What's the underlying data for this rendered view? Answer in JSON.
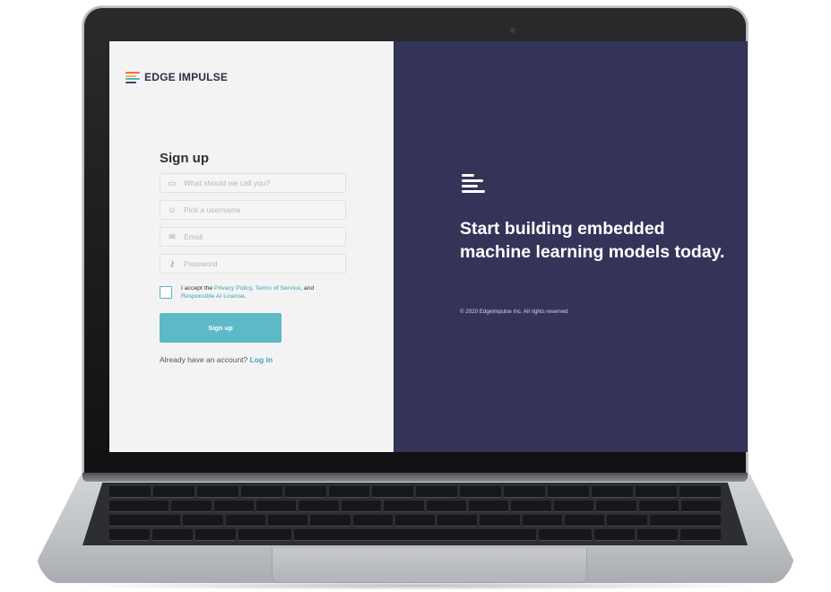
{
  "brand": {
    "name": "EDGE IMPULSE",
    "logo_colors": [
      "#f26d50",
      "#f7b733",
      "#4db6c5",
      "#3e3e6b"
    ]
  },
  "signup_form": {
    "title": "Sign up",
    "fields": [
      {
        "icon": "id-card-icon",
        "placeholder": "What should we call you?",
        "value": ""
      },
      {
        "icon": "user-icon",
        "placeholder": "Pick a username",
        "value": ""
      },
      {
        "icon": "mail-icon",
        "placeholder": "Email",
        "value": ""
      },
      {
        "icon": "key-icon",
        "placeholder": "Password",
        "value": ""
      }
    ],
    "terms": {
      "prefix": "I accept the ",
      "privacy_link": "Privacy Policy",
      "sep": ", ",
      "tos_link": "Terms of Service",
      "and": ", and",
      "ai_link": "Responsible AI License",
      "suffix": ".",
      "checked": false
    },
    "submit_label": "Sign up",
    "login_prompt": "Already have an account?",
    "login_link": "Log in"
  },
  "hero": {
    "headline": "Start building embedded machine learning models today.",
    "copyright": "© 2020 EdgeImpulse Inc. All rights reserved"
  },
  "colors": {
    "hero_background": "#343459",
    "form_background": "#f3f3f4",
    "accent": "#5db8c7",
    "link": "#3aa5b8"
  }
}
